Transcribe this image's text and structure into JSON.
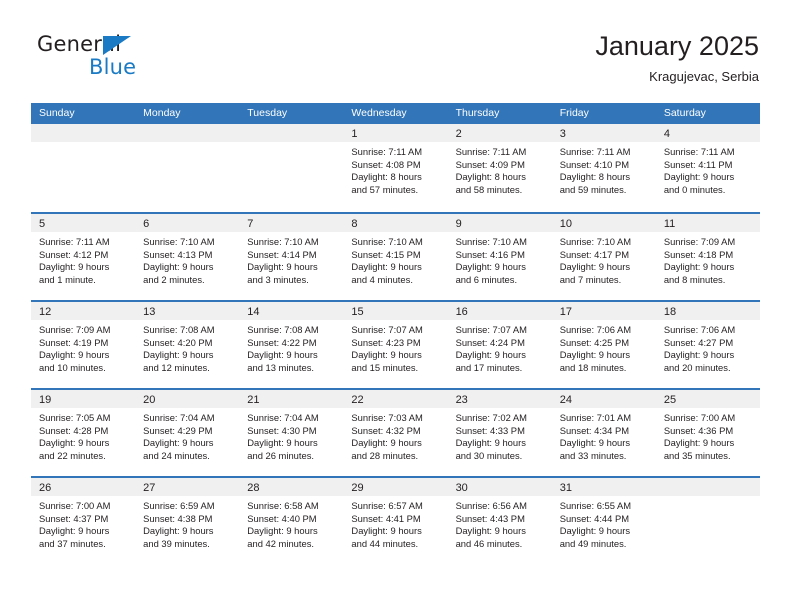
{
  "logo": {
    "text_top": "General",
    "text_bottom": "Blue",
    "accent_color": "#1a7ac4"
  },
  "header": {
    "title": "January 2025",
    "subtitle": "Kragujevac, Serbia"
  },
  "theme": {
    "header_blue": "#3275b8",
    "day_band_gray": "#f0f0f0",
    "text_dark": "#231f20"
  },
  "calendar": {
    "weekdays": [
      "Sunday",
      "Monday",
      "Tuesday",
      "Wednesday",
      "Thursday",
      "Friday",
      "Saturday"
    ],
    "weeks": [
      [
        {
          "day": "",
          "lines": []
        },
        {
          "day": "",
          "lines": []
        },
        {
          "day": "",
          "lines": []
        },
        {
          "day": "1",
          "lines": [
            "Sunrise: 7:11 AM",
            "Sunset: 4:08 PM",
            "Daylight: 8 hours",
            "and 57 minutes."
          ]
        },
        {
          "day": "2",
          "lines": [
            "Sunrise: 7:11 AM",
            "Sunset: 4:09 PM",
            "Daylight: 8 hours",
            "and 58 minutes."
          ]
        },
        {
          "day": "3",
          "lines": [
            "Sunrise: 7:11 AM",
            "Sunset: 4:10 PM",
            "Daylight: 8 hours",
            "and 59 minutes."
          ]
        },
        {
          "day": "4",
          "lines": [
            "Sunrise: 7:11 AM",
            "Sunset: 4:11 PM",
            "Daylight: 9 hours",
            "and 0 minutes."
          ]
        }
      ],
      [
        {
          "day": "5",
          "lines": [
            "Sunrise: 7:11 AM",
            "Sunset: 4:12 PM",
            "Daylight: 9 hours",
            "and 1 minute."
          ]
        },
        {
          "day": "6",
          "lines": [
            "Sunrise: 7:10 AM",
            "Sunset: 4:13 PM",
            "Daylight: 9 hours",
            "and 2 minutes."
          ]
        },
        {
          "day": "7",
          "lines": [
            "Sunrise: 7:10 AM",
            "Sunset: 4:14 PM",
            "Daylight: 9 hours",
            "and 3 minutes."
          ]
        },
        {
          "day": "8",
          "lines": [
            "Sunrise: 7:10 AM",
            "Sunset: 4:15 PM",
            "Daylight: 9 hours",
            "and 4 minutes."
          ]
        },
        {
          "day": "9",
          "lines": [
            "Sunrise: 7:10 AM",
            "Sunset: 4:16 PM",
            "Daylight: 9 hours",
            "and 6 minutes."
          ]
        },
        {
          "day": "10",
          "lines": [
            "Sunrise: 7:10 AM",
            "Sunset: 4:17 PM",
            "Daylight: 9 hours",
            "and 7 minutes."
          ]
        },
        {
          "day": "11",
          "lines": [
            "Sunrise: 7:09 AM",
            "Sunset: 4:18 PM",
            "Daylight: 9 hours",
            "and 8 minutes."
          ]
        }
      ],
      [
        {
          "day": "12",
          "lines": [
            "Sunrise: 7:09 AM",
            "Sunset: 4:19 PM",
            "Daylight: 9 hours",
            "and 10 minutes."
          ]
        },
        {
          "day": "13",
          "lines": [
            "Sunrise: 7:08 AM",
            "Sunset: 4:20 PM",
            "Daylight: 9 hours",
            "and 12 minutes."
          ]
        },
        {
          "day": "14",
          "lines": [
            "Sunrise: 7:08 AM",
            "Sunset: 4:22 PM",
            "Daylight: 9 hours",
            "and 13 minutes."
          ]
        },
        {
          "day": "15",
          "lines": [
            "Sunrise: 7:07 AM",
            "Sunset: 4:23 PM",
            "Daylight: 9 hours",
            "and 15 minutes."
          ]
        },
        {
          "day": "16",
          "lines": [
            "Sunrise: 7:07 AM",
            "Sunset: 4:24 PM",
            "Daylight: 9 hours",
            "and 17 minutes."
          ]
        },
        {
          "day": "17",
          "lines": [
            "Sunrise: 7:06 AM",
            "Sunset: 4:25 PM",
            "Daylight: 9 hours",
            "and 18 minutes."
          ]
        },
        {
          "day": "18",
          "lines": [
            "Sunrise: 7:06 AM",
            "Sunset: 4:27 PM",
            "Daylight: 9 hours",
            "and 20 minutes."
          ]
        }
      ],
      [
        {
          "day": "19",
          "lines": [
            "Sunrise: 7:05 AM",
            "Sunset: 4:28 PM",
            "Daylight: 9 hours",
            "and 22 minutes."
          ]
        },
        {
          "day": "20",
          "lines": [
            "Sunrise: 7:04 AM",
            "Sunset: 4:29 PM",
            "Daylight: 9 hours",
            "and 24 minutes."
          ]
        },
        {
          "day": "21",
          "lines": [
            "Sunrise: 7:04 AM",
            "Sunset: 4:30 PM",
            "Daylight: 9 hours",
            "and 26 minutes."
          ]
        },
        {
          "day": "22",
          "lines": [
            "Sunrise: 7:03 AM",
            "Sunset: 4:32 PM",
            "Daylight: 9 hours",
            "and 28 minutes."
          ]
        },
        {
          "day": "23",
          "lines": [
            "Sunrise: 7:02 AM",
            "Sunset: 4:33 PM",
            "Daylight: 9 hours",
            "and 30 minutes."
          ]
        },
        {
          "day": "24",
          "lines": [
            "Sunrise: 7:01 AM",
            "Sunset: 4:34 PM",
            "Daylight: 9 hours",
            "and 33 minutes."
          ]
        },
        {
          "day": "25",
          "lines": [
            "Sunrise: 7:00 AM",
            "Sunset: 4:36 PM",
            "Daylight: 9 hours",
            "and 35 minutes."
          ]
        }
      ],
      [
        {
          "day": "26",
          "lines": [
            "Sunrise: 7:00 AM",
            "Sunset: 4:37 PM",
            "Daylight: 9 hours",
            "and 37 minutes."
          ]
        },
        {
          "day": "27",
          "lines": [
            "Sunrise: 6:59 AM",
            "Sunset: 4:38 PM",
            "Daylight: 9 hours",
            "and 39 minutes."
          ]
        },
        {
          "day": "28",
          "lines": [
            "Sunrise: 6:58 AM",
            "Sunset: 4:40 PM",
            "Daylight: 9 hours",
            "and 42 minutes."
          ]
        },
        {
          "day": "29",
          "lines": [
            "Sunrise: 6:57 AM",
            "Sunset: 4:41 PM",
            "Daylight: 9 hours",
            "and 44 minutes."
          ]
        },
        {
          "day": "30",
          "lines": [
            "Sunrise: 6:56 AM",
            "Sunset: 4:43 PM",
            "Daylight: 9 hours",
            "and 46 minutes."
          ]
        },
        {
          "day": "31",
          "lines": [
            "Sunrise: 6:55 AM",
            "Sunset: 4:44 PM",
            "Daylight: 9 hours",
            "and 49 minutes."
          ]
        },
        {
          "day": "",
          "lines": []
        }
      ]
    ]
  }
}
